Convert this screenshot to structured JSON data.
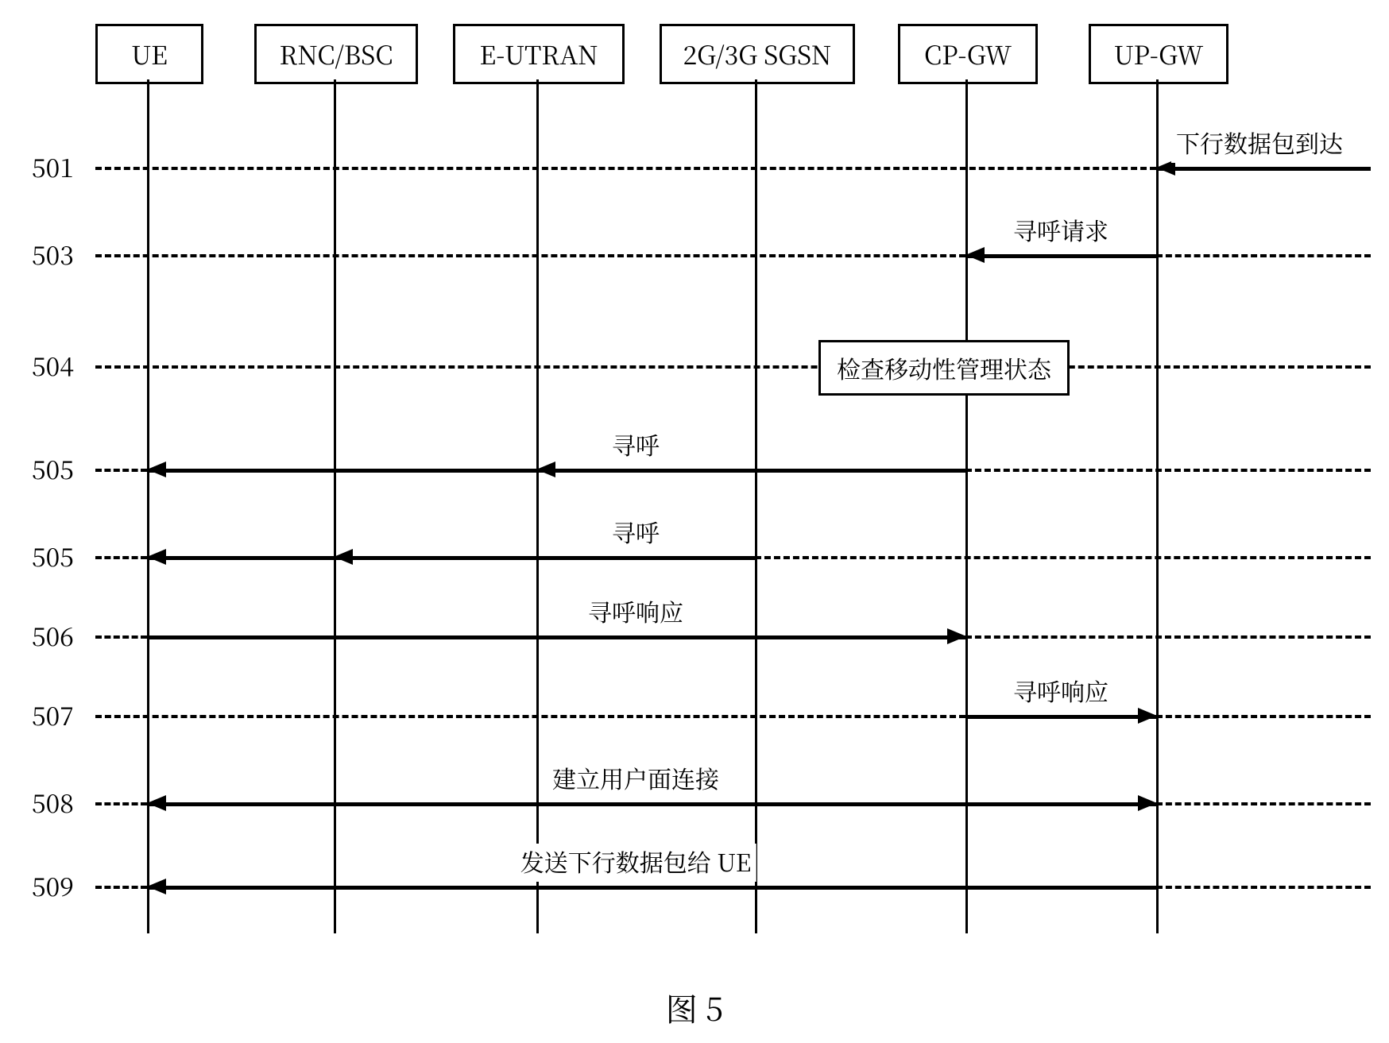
{
  "actors": {
    "ue": "UE",
    "rnc": "RNC/BSC",
    "eutran": "E-UTRAN",
    "sgsn": "2G/3G SGSN",
    "cpgw": "CP-GW",
    "upgw": "UP-GW"
  },
  "steps": {
    "s501": "501",
    "s503": "503",
    "s504": "504",
    "s505a": "505",
    "s505b": "505",
    "s506": "506",
    "s507": "507",
    "s508": "508",
    "s509": "509"
  },
  "messages": {
    "m501": "下行数据包到达",
    "m503": "寻呼请求",
    "m504": "检查移动性管理状态",
    "m505_top": "寻呼",
    "m505a_left": "",
    "m505b": "寻呼",
    "m506": "寻呼响应",
    "m507": "寻呼响应",
    "m508": "建立用户面连接",
    "m509": "发送下行数据包给 UE"
  },
  "caption": "图 5"
}
